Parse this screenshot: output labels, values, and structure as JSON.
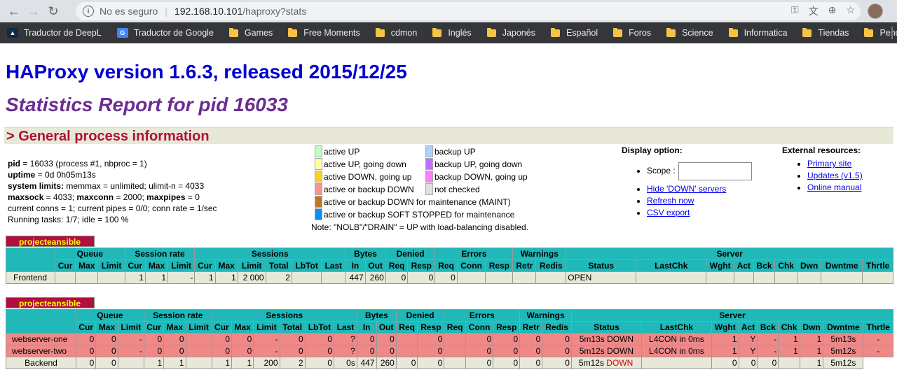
{
  "browser": {
    "security": "No es seguro",
    "host": "192.168.10.101",
    "path": "/haproxy?stats",
    "bookmarks": [
      "Traductor de DeepL",
      "Traductor de Google",
      "Games",
      "Free Moments",
      "cdmon",
      "Inglés",
      "Japonés",
      "Español",
      "Foros",
      "Science",
      "Informatica",
      "Tiendas",
      "Pendiente(?)"
    ]
  },
  "title": "HAProxy version 1.6.3, released 2015/12/25",
  "subtitle": "Statistics Report for pid 16033",
  "section": "> General process information",
  "process": {
    "pid_label": "pid",
    "pid_text": " = 16033 (process #1, nbproc = 1)",
    "uptime_label": "uptime",
    "uptime_text": " = 0d 0h05m13s",
    "limits_label": "system limits:",
    "limits_text": " memmax = unlimited; ulimit-n = 4033",
    "maxsock_label": "maxsock",
    "maxsock_text": " = 4033; ",
    "maxconn_label": "maxconn",
    "maxconn_text": " = 2000; ",
    "maxpipes_label": "maxpipes",
    "maxpipes_text": " = 0",
    "conns": "current conns = 1; current pipes = 0/0; conn rate = 1/sec",
    "tasks": "Running tasks: 1/7; idle = 100 %"
  },
  "legend": [
    {
      "label": "active UP",
      "color": "#c0ffc0"
    },
    {
      "label": "backup UP",
      "color": "#b0d0ff"
    },
    {
      "label": "active UP, going down",
      "color": "#ffffa0"
    },
    {
      "label": "backup UP, going down",
      "color": "#c070ff"
    },
    {
      "label": "active DOWN, going up",
      "color": "#ffd020"
    },
    {
      "label": "backup DOWN, going up",
      "color": "#ff80ff"
    },
    {
      "label": "active or backup DOWN",
      "color": "#ff9090"
    },
    {
      "label": "not checked",
      "color": "#e0e0e0"
    },
    {
      "label": "active or backup DOWN for maintenance (MAINT)",
      "color": "#c07820"
    },
    {
      "label": "active or backup SOFT STOPPED for maintenance",
      "color": "#0090ff"
    }
  ],
  "legend_note": "Note: \"NOLB\"/\"DRAIN\" = UP with load-balancing disabled.",
  "display": {
    "title": "Display option:",
    "scope": "Scope :",
    "hide": "Hide 'DOWN' servers",
    "refresh": "Refresh now",
    "csv": "CSV export"
  },
  "external": {
    "title": "External resources:",
    "primary": "Primary site",
    "updates": "Updates (v1.5)",
    "manual": "Online manual"
  },
  "frontend_table": {
    "name": "projecteansible",
    "groups": [
      "Queue",
      "Session rate",
      "Sessions",
      "Bytes",
      "Denied",
      "Errors",
      "Warnings",
      "Server"
    ],
    "cols": [
      "Cur",
      "Max",
      "Limit",
      "Cur",
      "Max",
      "Limit",
      "Cur",
      "Max",
      "Limit",
      "Total",
      "LbTot",
      "Last",
      "In",
      "Out",
      "Req",
      "Resp",
      "Req",
      "Conn",
      "Resp",
      "Retr",
      "Redis",
      "Status",
      "LastChk",
      "Wght",
      "Act",
      "Bck",
      "Chk",
      "Dwn",
      "Dwntme",
      "Thrtle"
    ],
    "row": [
      "Frontend",
      "",
      "",
      "",
      "1",
      "1",
      "-",
      "1",
      "1",
      "2 000",
      "2",
      "",
      "",
      "447",
      "260",
      "0",
      "0",
      "0",
      "",
      "",
      "",
      "",
      "OPEN",
      "",
      "",
      "",
      "",
      "",
      "",
      "",
      ""
    ]
  },
  "backend_table": {
    "name": "projecteansible",
    "rows": [
      [
        "webserver-one",
        "0",
        "0",
        "-",
        "0",
        "0",
        "",
        "0",
        "0",
        "-",
        "0",
        "0",
        "?",
        "0",
        "0",
        "",
        "0",
        "",
        "0",
        "0",
        "0",
        "0",
        "5m13s DOWN",
        "L4CON in 0ms",
        "1",
        "Y",
        "-",
        "1",
        "1",
        "5m13s",
        "-"
      ],
      [
        "webserver-two",
        "0",
        "0",
        "-",
        "0",
        "0",
        "",
        "0",
        "0",
        "-",
        "0",
        "0",
        "?",
        "0",
        "0",
        "",
        "0",
        "",
        "0",
        "0",
        "0",
        "0",
        "5m12s DOWN",
        "L4CON in 0ms",
        "1",
        "Y",
        "-",
        "1",
        "1",
        "5m12s",
        "-"
      ],
      [
        "Backend",
        "0",
        "0",
        "",
        "1",
        "1",
        "",
        "1",
        "1",
        "200",
        "2",
        "0",
        "0s",
        "447",
        "260",
        "0",
        "0",
        "",
        "0",
        "0",
        "0",
        "0",
        "5m12s",
        "DOWN",
        "",
        "0",
        "0",
        "0",
        "",
        "1",
        "5m12s"
      ]
    ]
  },
  "colors": {
    "accent": "#20b8b8",
    "header_bg": "#b0103e",
    "down_row": "#f08888",
    "neutral_row": "#e8e8d8"
  }
}
